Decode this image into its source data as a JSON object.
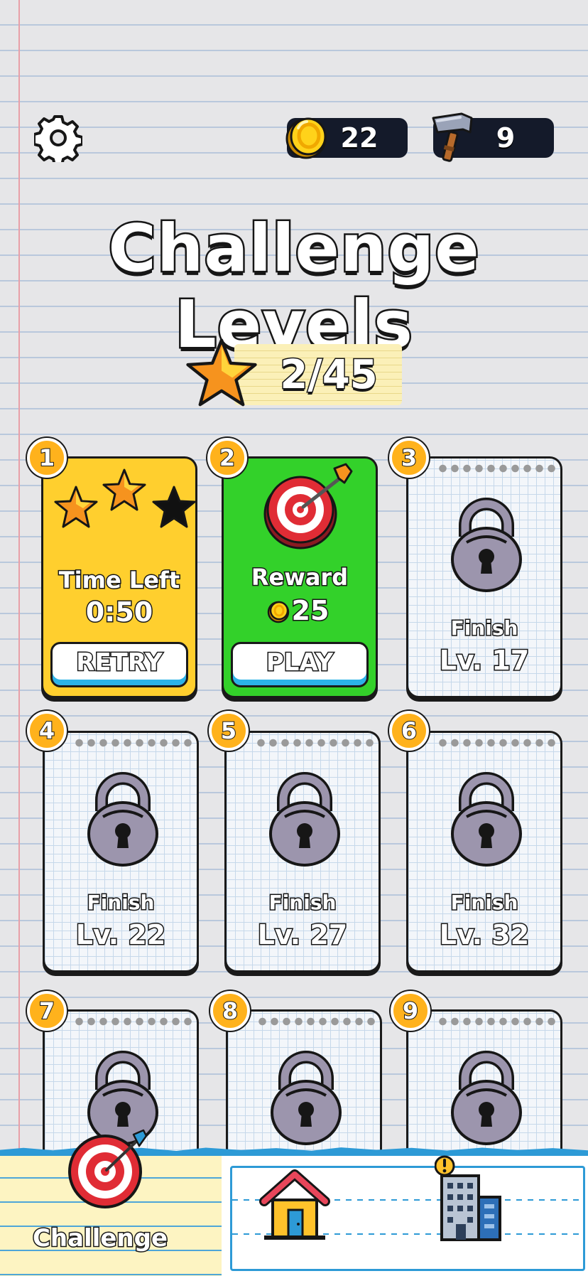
{
  "header": {
    "settings_icon": "gear-icon",
    "coins": "22",
    "coin_icon": "coin-icon",
    "hammers": "9",
    "hammer_icon": "hammer-icon"
  },
  "title": "Challenge Levels",
  "progress": {
    "icon": "star-icon",
    "text": "2/45"
  },
  "levels": [
    {
      "number": "1",
      "state": "completed",
      "stars_earned": 2,
      "stars_total": 3,
      "label": "Time Left",
      "value": "0:50",
      "button": "RETRY"
    },
    {
      "number": "2",
      "state": "current",
      "icon": "target-icon",
      "label": "Reward",
      "value": "25",
      "button": "PLAY"
    },
    {
      "number": "3",
      "state": "locked",
      "line1": "Finish",
      "line2": "Lv. 17"
    },
    {
      "number": "4",
      "state": "locked",
      "line1": "Finish",
      "line2": "Lv. 22"
    },
    {
      "number": "5",
      "state": "locked",
      "line1": "Finish",
      "line2": "Lv. 27"
    },
    {
      "number": "6",
      "state": "locked",
      "line1": "Finish",
      "line2": "Lv. 32"
    },
    {
      "number": "7",
      "state": "locked"
    },
    {
      "number": "8",
      "state": "locked"
    },
    {
      "number": "9",
      "state": "locked"
    }
  ],
  "nav": {
    "challenge_label": "Challenge",
    "challenge_icon": "target-icon",
    "home_icon": "house-icon",
    "city_icon": "building-icon",
    "city_alert_icon": "exclamation-icon"
  },
  "colors": {
    "gold_card": "#ffcf2e",
    "green_card": "#33d12a",
    "badge": "#ffb21c",
    "accent_blue": "#2d9ad6"
  }
}
